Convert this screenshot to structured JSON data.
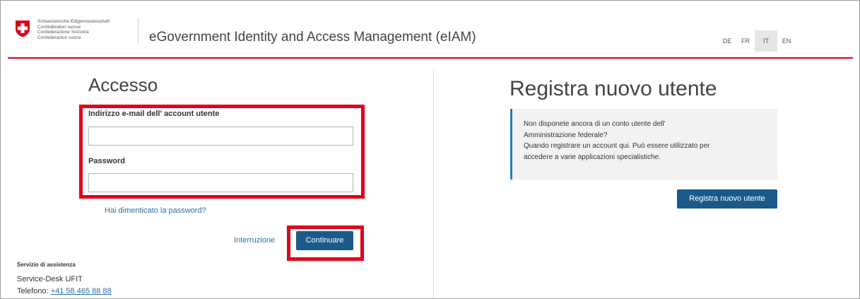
{
  "header": {
    "confederation_lines": [
      "Schweizerische Eidgenossenschaft",
      "Confédération suisse",
      "Confederazione Svizzera",
      "Confederaziun svizra"
    ],
    "app_title": "eGovernment Identity and Access Management (eIAM)",
    "languages": [
      "DE",
      "FR",
      "IT",
      "EN"
    ],
    "active_language": "IT",
    "logo_icon": "swiss-cross-shield-icon"
  },
  "login": {
    "title": "Accesso",
    "email_label": "Indirizzo e-mail dell' account utente",
    "email_value": "",
    "password_label": "Password",
    "password_value": "",
    "forgot_password": "Hai dimenticato la password?",
    "cancel_label": "Interruzione",
    "continue_label": "Continuare"
  },
  "support": {
    "heading": "Servizio di assistenza",
    "desk": "Service-Desk UFIT",
    "phone_label": "Telefono:",
    "phone_number": "+41 58 465 88 88"
  },
  "register": {
    "title": "Registra nuovo utente",
    "info_lines": [
      "Non disponete ancora di un conto utente dell'",
      "Amministrazione federale?",
      "Quando registrare un account qui. Può essere utilizzato per",
      "accedere a varie applicazioni specialistiche."
    ],
    "button_label": "Registra nuovo utente"
  },
  "colors": {
    "accent_red": "#dc0018",
    "button_blue": "#1a5a8a",
    "link_blue": "#2b6fa6",
    "highlight_box": "#e2001a"
  }
}
